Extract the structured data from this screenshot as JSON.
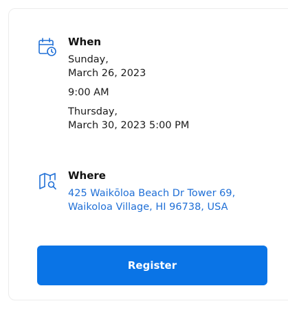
{
  "when": {
    "label": "When",
    "start_day": "Sunday,",
    "start_date": "March 26, 2023",
    "start_time": "9:00 AM",
    "end_day": "Thursday,",
    "end_datetime": "March 30, 2023 5:00 PM",
    "icon": "calendar-clock-icon"
  },
  "where": {
    "label": "Where",
    "address_line1": "425 Waikōloa Beach Dr Tower 69,",
    "address_line2": "Waikoloa Village, HI 96738, USA",
    "icon": "map-search-icon"
  },
  "actions": {
    "register_label": "Register"
  },
  "colors": {
    "accent": "#0a74e6",
    "link": "#1f6fd6"
  }
}
